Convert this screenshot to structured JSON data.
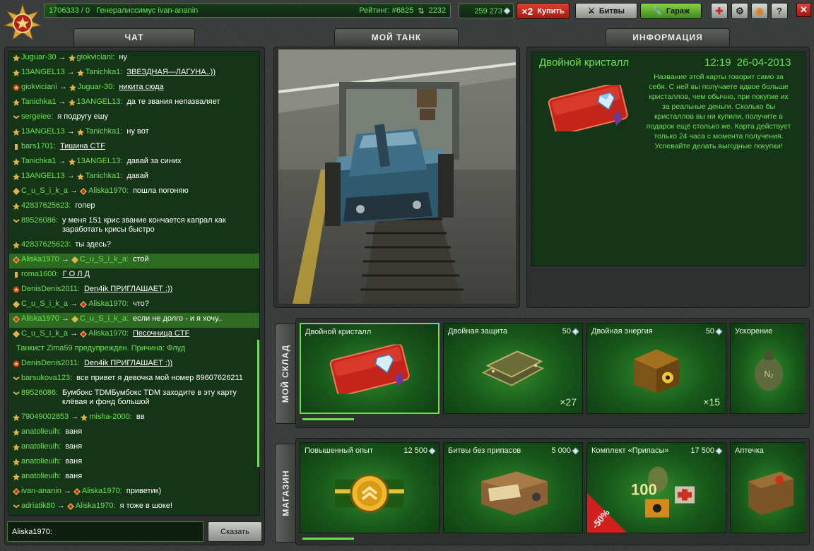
{
  "topbar": {
    "progress_text": "1706333 / 0",
    "rank_name": "Генералиссимус",
    "username": "ivan-ananin",
    "rating": "Рейтинг: #6825",
    "rating_change": "2232",
    "crystals": "259 273",
    "buy_multiplier": "×2",
    "buy_label": "Купить",
    "battles_label": "Битвы",
    "garage_label": "Гараж",
    "progress_fraction": 0.03
  },
  "tabs": {
    "chat": "ЧАТ",
    "my_tank": "МОЙ ТАНК",
    "info": "ИНФОРМАЦИЯ",
    "warehouse": "МОЙ СКЛАД",
    "shop": "МАГАЗИН"
  },
  "chat": {
    "messages": [
      {
        "from": "Juguar-30",
        "to": "giokviciani",
        "text": "ну",
        "rank": "gold"
      },
      {
        "from": "13ANGEL13",
        "to": "Tanichka1",
        "text": "ЗВЕЗДНАЯ—ЛАГУНА..))",
        "underline": true,
        "rank": "gold"
      },
      {
        "from": "giokviciani",
        "to": "Juguar-30",
        "text": "никита сюда",
        "underline": true,
        "rank": "star"
      },
      {
        "from": "Tanichka1",
        "to": "13ANGEL13",
        "text": "да те звания непазваляет",
        "rank": "gold"
      },
      {
        "from": "sergeiee",
        "to": "",
        "text": "я подругу ешу",
        "rank": "chev"
      },
      {
        "from": "13ANGEL13",
        "to": "Tanichka1",
        "text": "ну вот",
        "rank": "gold"
      },
      {
        "from": "bars1701",
        "to": "",
        "text": "Тишина CTF",
        "underline": true,
        "rank": "bar"
      },
      {
        "from": "Tanichka1",
        "to": "13ANGEL13",
        "text": "давай за синих",
        "rank": "gold"
      },
      {
        "from": "13ANGEL13",
        "to": "Tanichka1",
        "text": "давай",
        "rank": "gold"
      },
      {
        "from": "C_u_S_i_k_a",
        "to": "Aliska1970",
        "text": "пошла погоняю",
        "rank": "diamond"
      },
      {
        "from": "42837625623",
        "to": "",
        "text": "гопер",
        "rank": "gold"
      },
      {
        "from": "89526086",
        "to": "",
        "text": "у меня 151 крис звание кончается капрал как заработать крисы быстро",
        "two": true,
        "rank": "chev"
      },
      {
        "from": "42837625623",
        "to": "",
        "text": "ты здесь?",
        "rank": "gold"
      },
      {
        "from": "Aliska1970",
        "to": "C_u_S_i_k_a",
        "text": "стой",
        "highlight": true,
        "rank": "red"
      },
      {
        "from": "roma1600",
        "to": "",
        "text": "Г О Л Д",
        "underline": true,
        "rank": "bar"
      },
      {
        "from": "DenisDenis2011",
        "to": "",
        "text": "Den4ik ПРИГЛАШАЕТ :))",
        "underline": true,
        "rank": "star"
      },
      {
        "from": "C_u_S_i_k_a",
        "to": "Aliska1970",
        "text": "что?",
        "rank": "diamond"
      },
      {
        "from": "Aliska1970",
        "to": "C_u_S_i_k_a",
        "text": "если не долго - и я хочу..",
        "highlight": true,
        "rank": "red"
      },
      {
        "from": "C_u_S_i_k_a",
        "to": "Aliska1970",
        "text": "Песочница CTF",
        "underline": true,
        "rank": "diamond"
      },
      {
        "system": true,
        "text": "Танкист Zima59 предупрежден. Причина: Флуд"
      },
      {
        "from": "DenisDenis2011",
        "to": "",
        "text": "Den4ik ПРИГЛАШАЕТ :))",
        "underline": true,
        "rank": "star"
      },
      {
        "from": "barsukova123",
        "to": "",
        "text": "все привет я девочка мой номер 89607626211",
        "rank": "chev"
      },
      {
        "from": "89526086",
        "to": "",
        "text": "Бумбокс TDMБумбокс TDM заходите в эту карту клёвая и фонд большой",
        "two": true,
        "underline_part": true,
        "rank": "chev"
      },
      {
        "from": "79049002853",
        "to": "misha-2000",
        "text": "вв",
        "rank": "gold"
      },
      {
        "from": "anatolieuih",
        "to": "",
        "text": "ваня",
        "rank": "gold"
      },
      {
        "from": "anatolieuih",
        "to": "",
        "text": "ваня",
        "rank": "gold"
      },
      {
        "from": "anatolieuih",
        "to": "",
        "text": "ваня",
        "rank": "gold"
      },
      {
        "from": "anatolieuih",
        "to": "",
        "text": "ваня",
        "rank": "gold"
      },
      {
        "from": "ivan-ananin",
        "to": "Aliska1970",
        "text": "приветик)",
        "rank": "red"
      },
      {
        "from": "adriatik80",
        "to": "Aliska1970",
        "text": "я тоже в шоке!",
        "rank": "chev"
      }
    ],
    "input_value": "Aliska1970:",
    "send_label": "Сказать"
  },
  "info": {
    "title": "Двойной кристалл",
    "time": "12:19",
    "date": "26-04-2013",
    "description": "Название этой карты говорит само за себя. С ней вы получаете вдвое больше кристаллов, чем обычно, при покупке их за реальные деньги. Сколько бы кристаллов вы ни купили, получите в подарок ещё столько же. Карта действует только 24 часа с момента получения. Успевайте делать выгодные покупки!"
  },
  "warehouse": {
    "items": [
      {
        "name": "Двойной кристалл",
        "price": "",
        "count": "",
        "icon": "crystal-card",
        "selected": true
      },
      {
        "name": "Двойная защита",
        "price": "50",
        "count": "×27",
        "icon": "armor-plates"
      },
      {
        "name": "Двойная энергия",
        "price": "50",
        "count": "×15",
        "icon": "energy-crate"
      },
      {
        "name": "Ускорение",
        "price": "",
        "count": "",
        "icon": "nitro"
      }
    ]
  },
  "shop": {
    "items": [
      {
        "name": "Повышенный опыт",
        "price": "12 500",
        "icon": "xp-badge"
      },
      {
        "name": "Битвы без припасов",
        "price": "5 000",
        "icon": "wooden-box"
      },
      {
        "name": "Комплект «Припасы»",
        "price": "17 500",
        "icon": "supplies-kit",
        "discount": "-50%"
      },
      {
        "name": "Аптечка",
        "price": "",
        "icon": "medkit"
      }
    ],
    "kit_label": "100"
  },
  "colors": {
    "accent_green": "#6be24f",
    "panel_green": "#153517",
    "buy_red": "#e23c2a"
  }
}
